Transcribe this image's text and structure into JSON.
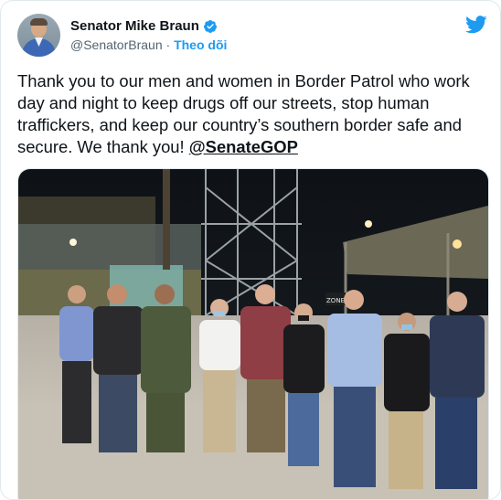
{
  "author": {
    "name": "Senator Mike Braun",
    "handle": "@SenatorBraun",
    "separator": "·",
    "follow_label": "Theo dõi",
    "verified_icon": "verified-badge-icon"
  },
  "tweet": {
    "text": "Thank you to our men and women in Border Patrol who work day and night to keep drugs off our streets, stop human traffickers, and keep our country’s southern border safe and secure. We thank you! ",
    "mention": "@SenateGOP"
  },
  "photo": {
    "sign_text": "ZONE"
  },
  "colors": {
    "accent": "#1d9bf0",
    "text": "#0f1419",
    "muted": "#536471"
  }
}
